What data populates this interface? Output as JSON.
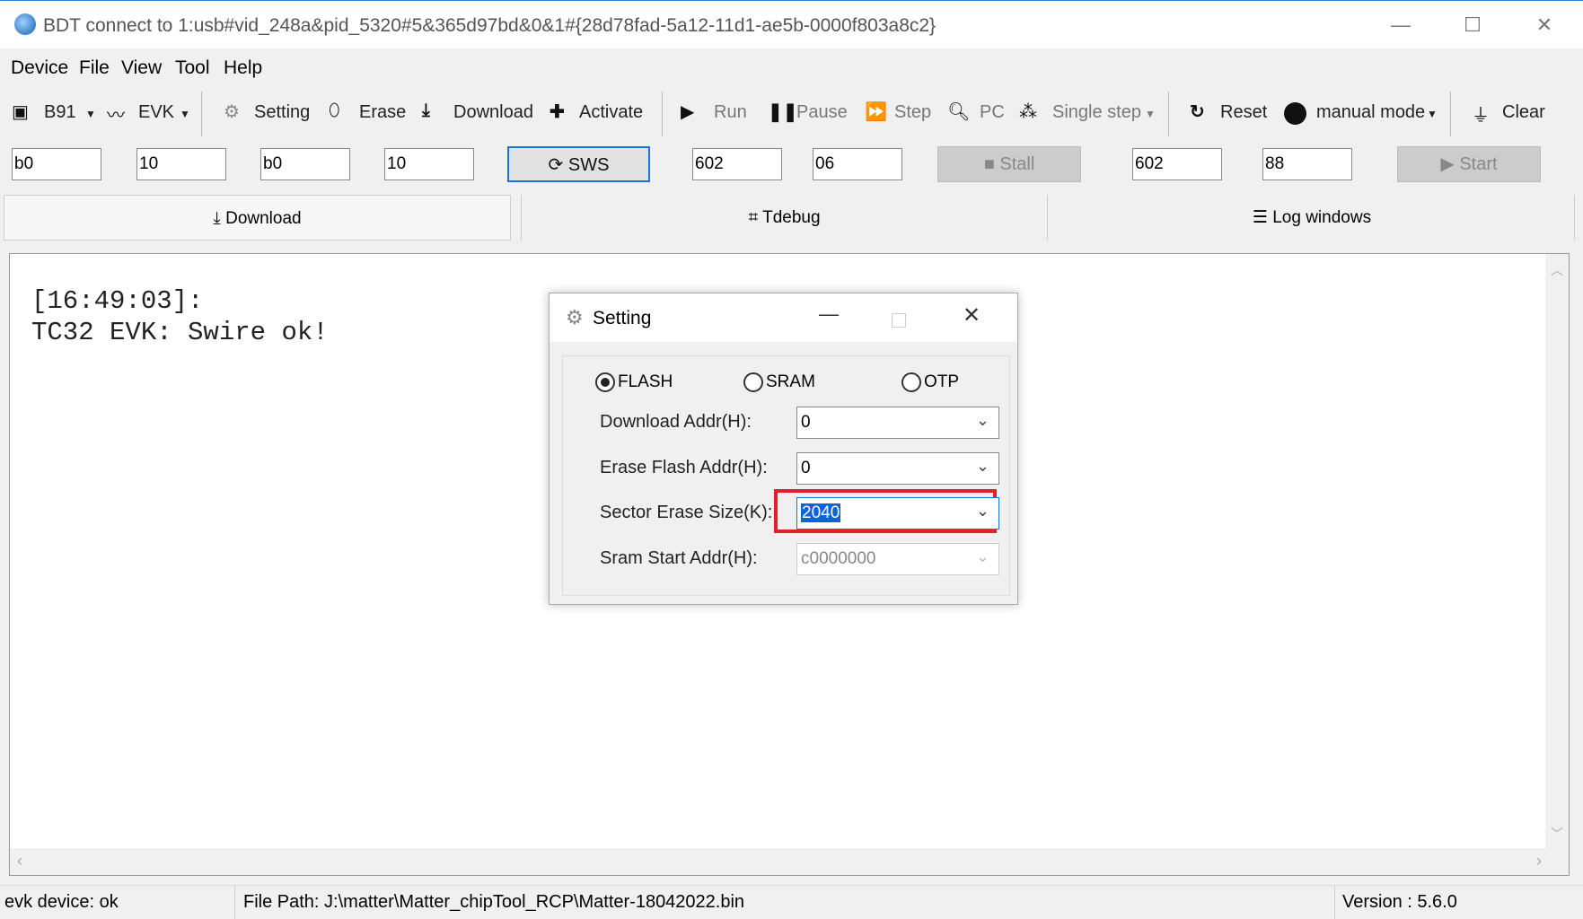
{
  "window": {
    "title": "BDT connect to 1:usb#vid_248a&pid_5320#5&365d97bd&0&1#{28d78fad-5a12-11d1-ae5b-0000f803a8c2}",
    "minimize": "—",
    "maximize": "☐",
    "close": "✕"
  },
  "menu": [
    "Device",
    "File",
    "View",
    "Tool",
    "Help"
  ],
  "toolbar": {
    "chip": "B91",
    "board": "EVK",
    "setting": "Setting",
    "erase": "Erase",
    "download": "Download",
    "activate": "Activate",
    "run": "Run",
    "pause": "Pause",
    "step": "Step",
    "pc": "PC",
    "single_step": "Single step",
    "reset": "Reset",
    "mode": "manual mode",
    "clear": "Clear"
  },
  "inputs": {
    "f1": "b0",
    "f2": "10",
    "f3": "b0",
    "f4": "10",
    "sws": "SWS",
    "f5": "602",
    "f6": "06",
    "stall": "Stall",
    "f7": "602",
    "f8": "88",
    "start": "Start"
  },
  "tabs": [
    "Download",
    "Tdebug",
    "Log windows"
  ],
  "log": [
    "[16:49:03]:",
    "TC32 EVK: Swire ok!"
  ],
  "status": {
    "device": "evk device: ok",
    "file_path": "File Path:  J:\\matter\\Matter_chipTool_RCP\\Matter-18042022.bin",
    "version": "Version : 5.6.0"
  },
  "dialog": {
    "title": "Setting",
    "memory_options": [
      "FLASH",
      "SRAM",
      "OTP"
    ],
    "selected_memory": "FLASH",
    "rows": [
      {
        "label": "Download  Addr(H):",
        "value": "0"
      },
      {
        "label": "Erase Flash Addr(H):",
        "value": "0"
      },
      {
        "label": "Sector Erase Size(K):",
        "value": "2040"
      },
      {
        "label": "Sram Start Addr(H):",
        "value": "c0000000"
      }
    ],
    "highlight_color": "#e0202a"
  }
}
